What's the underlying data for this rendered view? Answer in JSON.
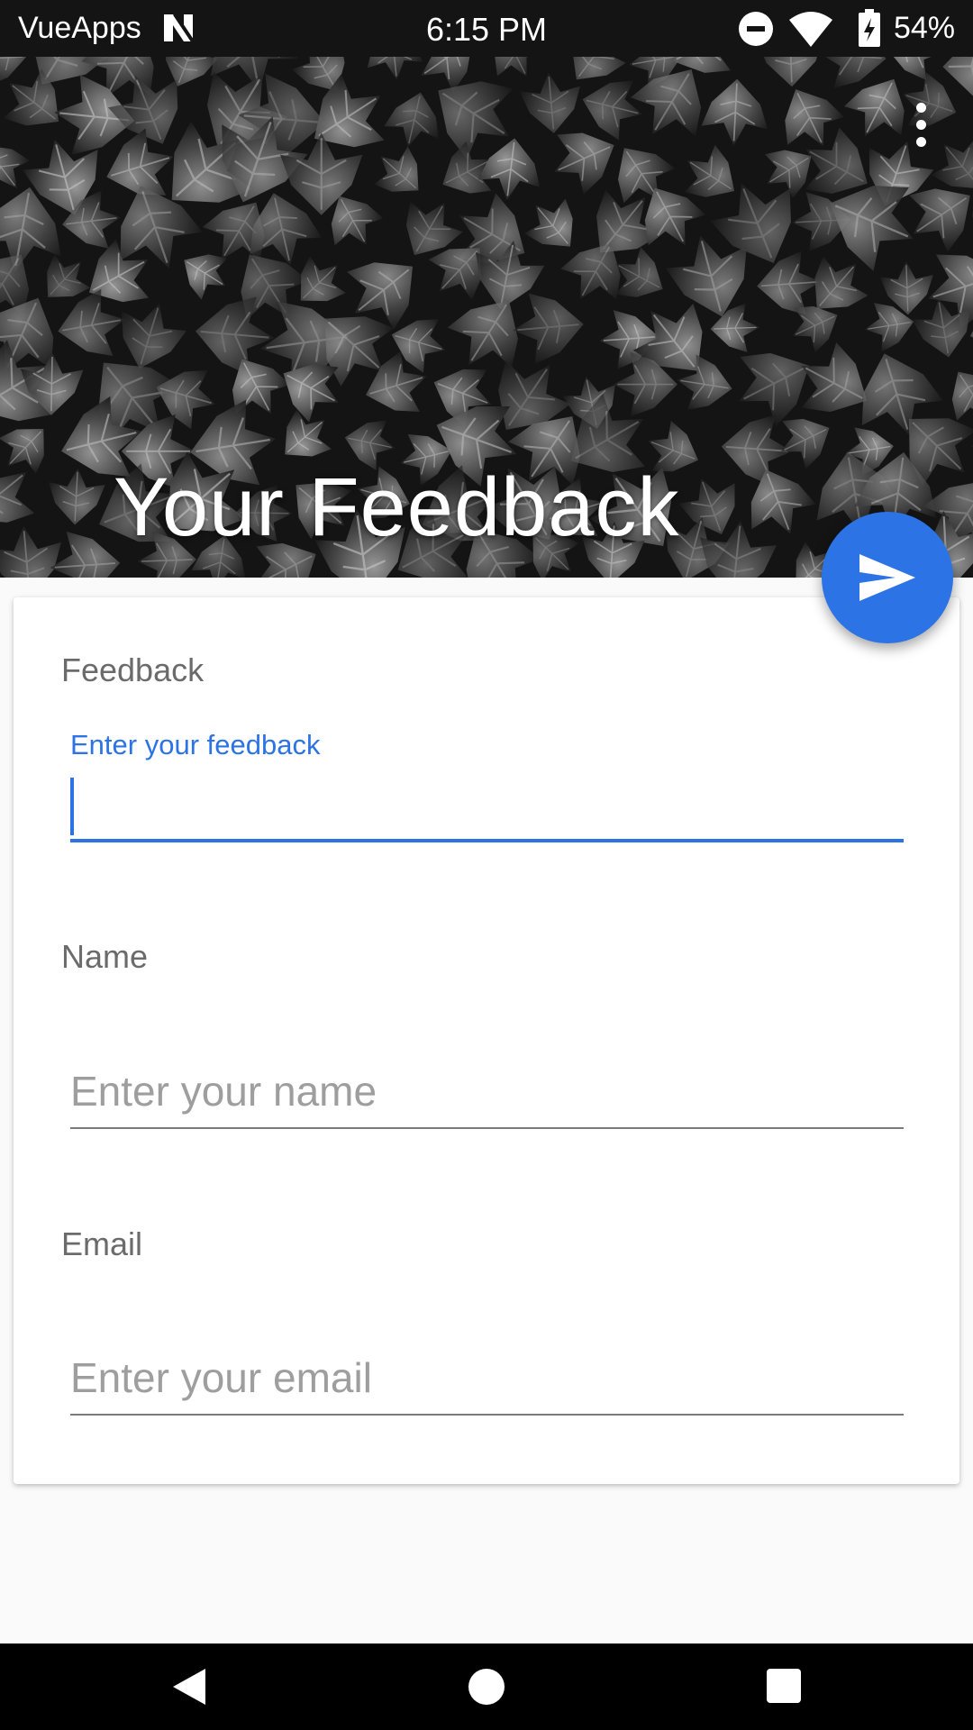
{
  "status_bar": {
    "app_name": "VueApps",
    "time": "6:15 PM",
    "battery": "54%"
  },
  "header": {
    "title": "Your Feedback",
    "menu_icon": "more-vert-icon"
  },
  "fab": {
    "icon": "send-icon",
    "color": "#2c73e6"
  },
  "form": {
    "feedback": {
      "section_label": "Feedback",
      "floating_label": "Enter your feedback",
      "value": ""
    },
    "name": {
      "section_label": "Name",
      "placeholder": "Enter your name",
      "value": ""
    },
    "email": {
      "section_label": "Email",
      "placeholder": "Enter your email",
      "value": ""
    }
  },
  "nav_bar": {
    "back_icon": "back-triangle-icon",
    "home_icon": "home-circle-icon",
    "recents_icon": "recents-square-icon"
  },
  "colors": {
    "accent": "#2c73e6",
    "status_bar": "#141414"
  }
}
